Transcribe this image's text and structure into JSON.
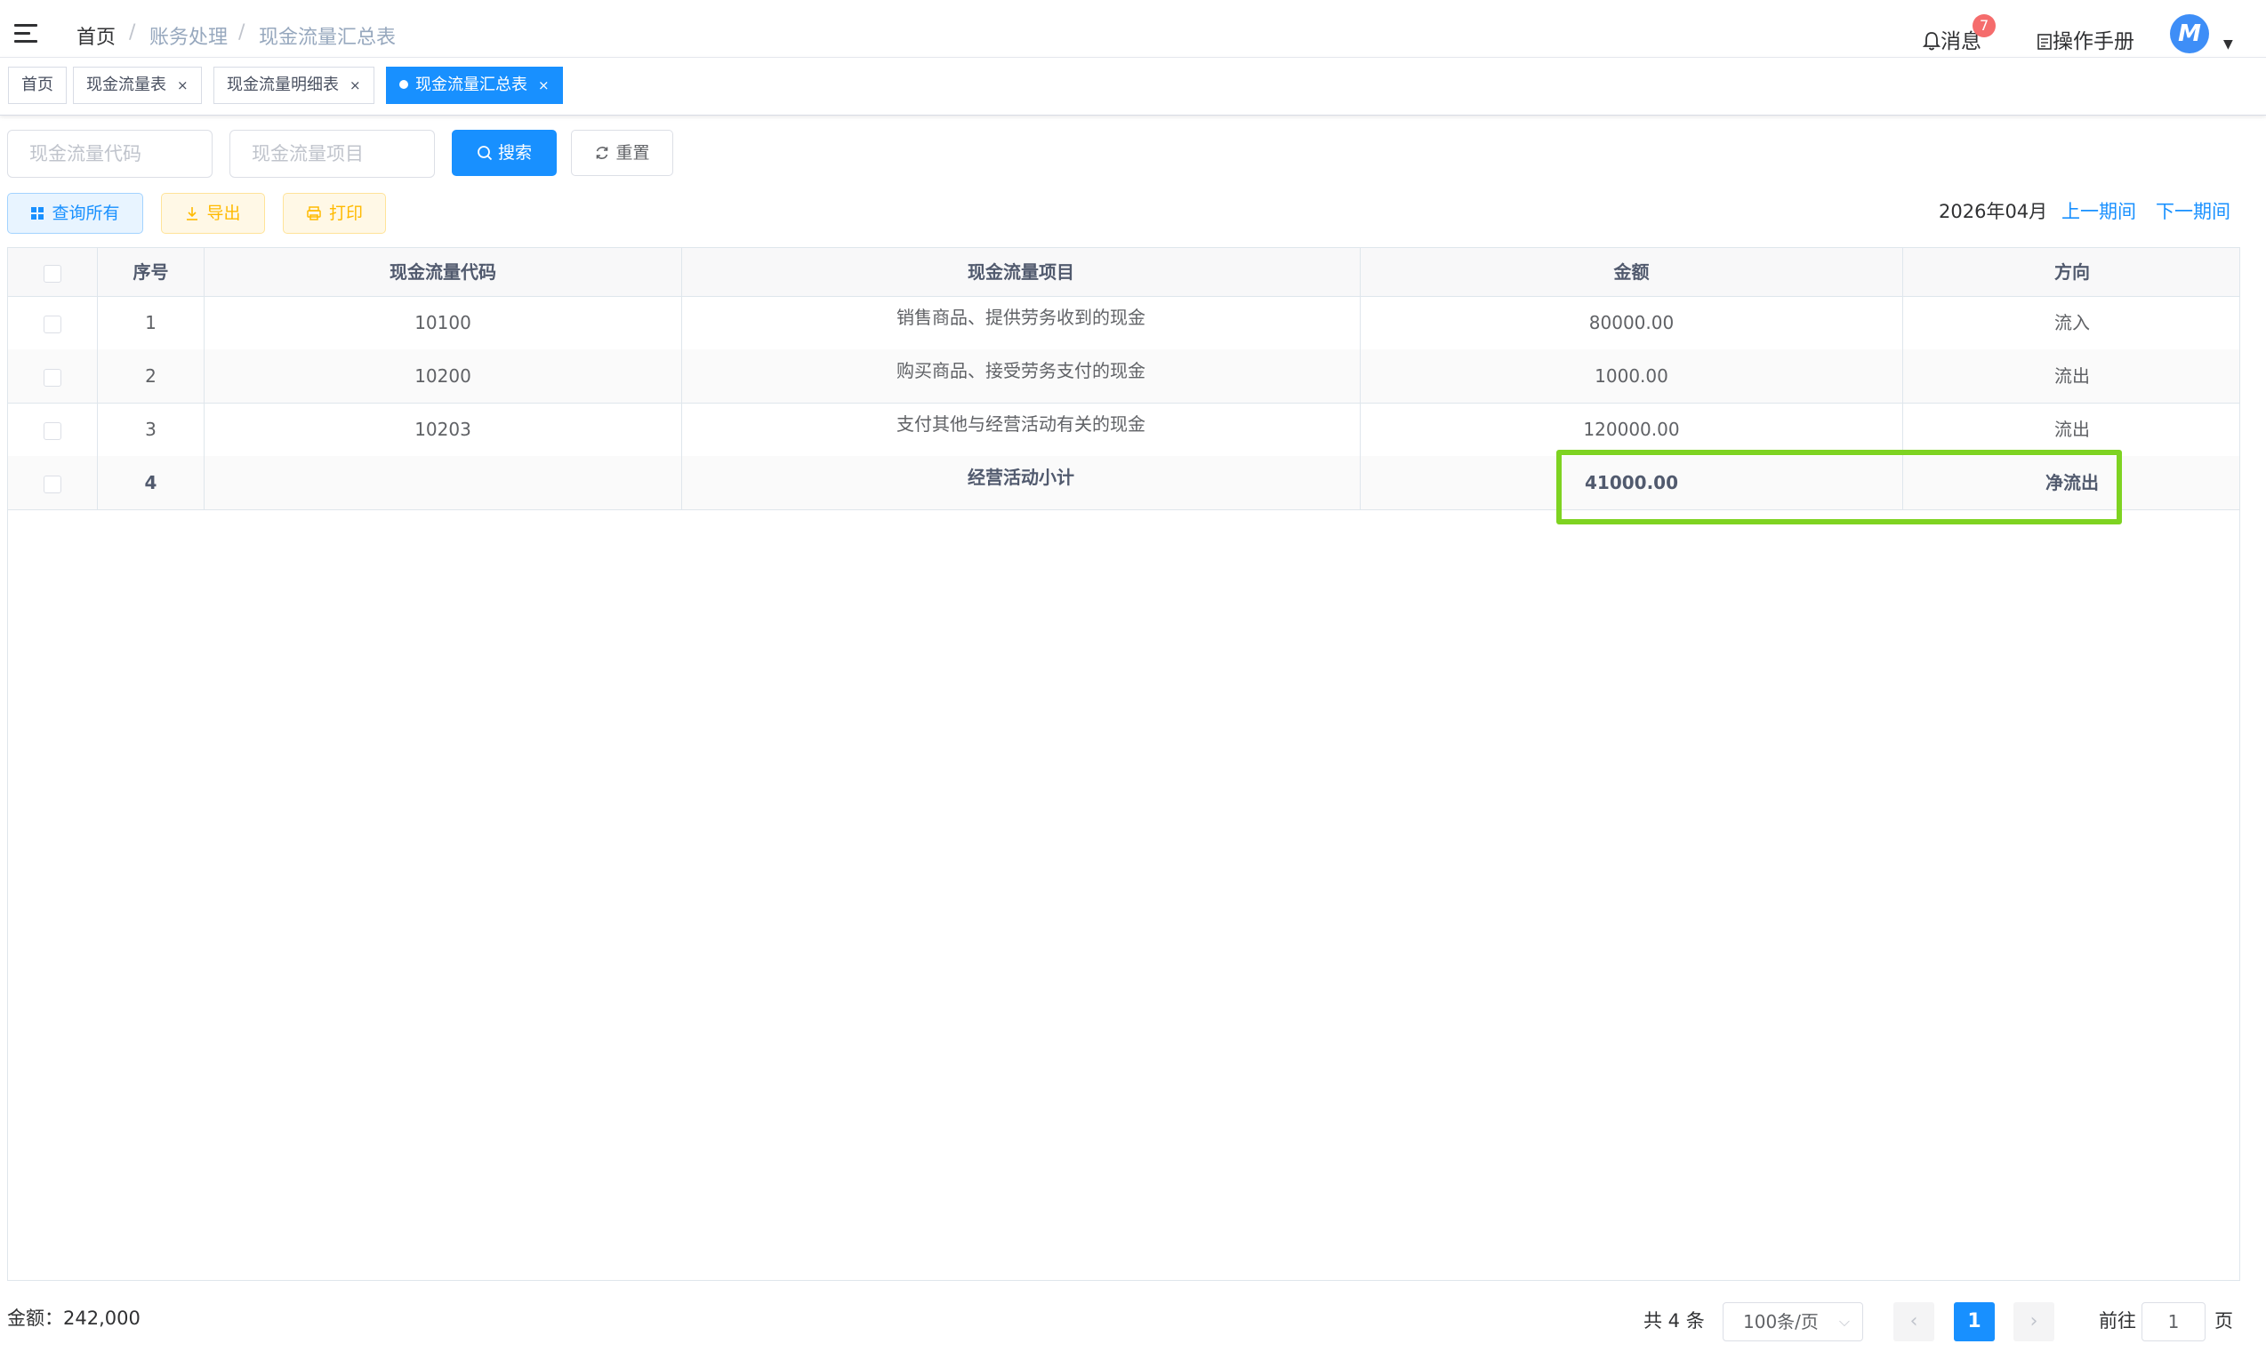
{
  "header": {
    "breadcrumb": [
      "首页",
      "账务处理",
      "现金流量汇总表"
    ],
    "breadcrumb_sep": "/",
    "notifications_label": "消息",
    "notifications_count": "7",
    "manual_label": "操作手册",
    "avatar_letter": "M"
  },
  "tabs": [
    {
      "label": "首页",
      "closable": false
    },
    {
      "label": "现金流量表",
      "closable": true
    },
    {
      "label": "现金流量明细表",
      "closable": true
    },
    {
      "label": "现金流量汇总表",
      "closable": true,
      "active": true
    }
  ],
  "close_glyph": "×",
  "search": {
    "code_placeholder": "现金流量代码",
    "item_placeholder": "现金流量项目",
    "search_label": "搜索",
    "reset_label": "重置"
  },
  "toolbar": {
    "query_all_label": "查询所有",
    "export_label": "导出",
    "print_label": "打印",
    "period": "2026年04月",
    "prev_period": "上一期间",
    "next_period": "下一期间"
  },
  "table": {
    "columns": [
      "序号",
      "现金流量代码",
      "现金流量项目",
      "金额",
      "方向"
    ],
    "rows": [
      {
        "no": "1",
        "code": "10100",
        "item": "销售商品、提供劳务收到的现金",
        "amount": "80000.00",
        "direction": "流入"
      },
      {
        "no": "2",
        "code": "10200",
        "item": "购买商品、接受劳务支付的现金",
        "amount": "1000.00",
        "direction": "流出"
      },
      {
        "no": "3",
        "code": "10203",
        "item": "支付其他与经营活动有关的现金",
        "amount": "120000.00",
        "direction": "流出"
      },
      {
        "no": "4",
        "code": "",
        "item": "经营活动小计",
        "amount": "41000.00",
        "direction": "净流出",
        "subtotal": true
      }
    ]
  },
  "footer": {
    "total_label": "金额：242,000",
    "count_label": "共 4 条",
    "page_size": "100条/页",
    "current_page": "1",
    "goto_label": "前往",
    "goto_value": "1",
    "page_unit": "页"
  },
  "colors": {
    "primary": "#1890ff",
    "highlight": "#7ed321",
    "warning": "#ffba00",
    "badge": "#f56c6c"
  }
}
